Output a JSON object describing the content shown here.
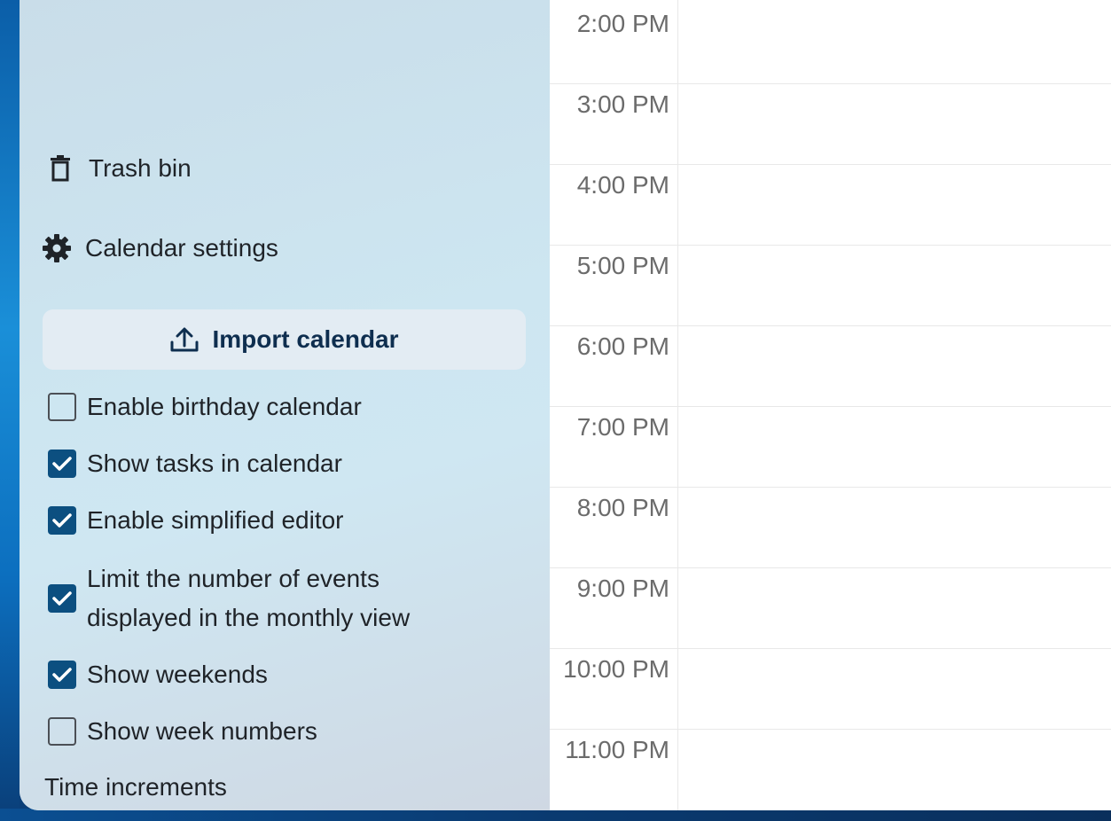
{
  "sidebar": {
    "trash_label": "Trash bin",
    "settings_label": "Calendar settings",
    "import_label": "Import calendar",
    "options": [
      {
        "label": "Enable birthday calendar",
        "checked": false
      },
      {
        "label": "Show tasks in calendar",
        "checked": true
      },
      {
        "label": "Enable simplified editor",
        "checked": true
      },
      {
        "label": "Limit the number of events",
        "label2": "displayed in the monthly view",
        "checked": true
      },
      {
        "label": "Show weekends",
        "checked": true
      },
      {
        "label": "Show week numbers",
        "checked": false
      }
    ],
    "time_increments_label": "Time increments"
  },
  "grid": {
    "hours": [
      "2:00 PM",
      "3:00 PM",
      "4:00 PM",
      "5:00 PM",
      "6:00 PM",
      "7:00 PM",
      "8:00 PM",
      "9:00 PM",
      "10:00 PM",
      "11:00 PM"
    ]
  },
  "colors": {
    "accent": "#0c4f80",
    "sidebar_bg": "#cde6f1"
  },
  "icons": {
    "trash": "trash-icon",
    "settings": "gear-icon",
    "import": "upload-icon",
    "checkbox": "check-icon"
  }
}
